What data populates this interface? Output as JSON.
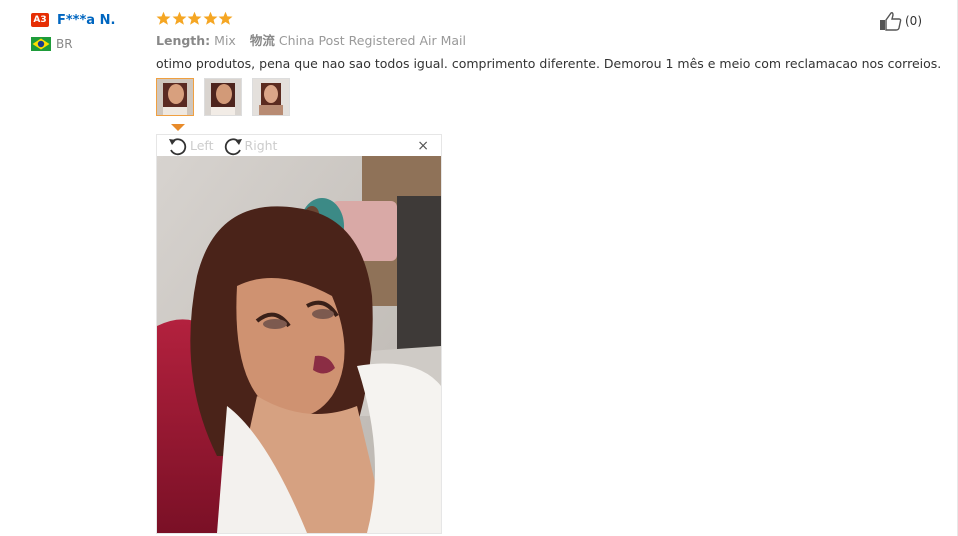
{
  "user": {
    "level_badge": "A3",
    "name": "F***a N.",
    "country": "BR"
  },
  "review": {
    "stars": 5,
    "length_label": "Length:",
    "length_value": "Mix",
    "shipping_label": "物流",
    "shipping_value": "China Post Registered Air Mail",
    "text": "otimo produtos, pena que nao sao todos igual. comprimento diferente. Demorou 1 mês e meio com reclamacao nos correios.",
    "thumbnail_count": 3
  },
  "viewer": {
    "rotate_left_label": "Left",
    "rotate_right_label": "Right",
    "close_glyph": "×"
  },
  "like": {
    "count": "(0)"
  },
  "colors": {
    "link": "#0066c0",
    "star": "#f5a623",
    "badge": "#e62e04"
  }
}
